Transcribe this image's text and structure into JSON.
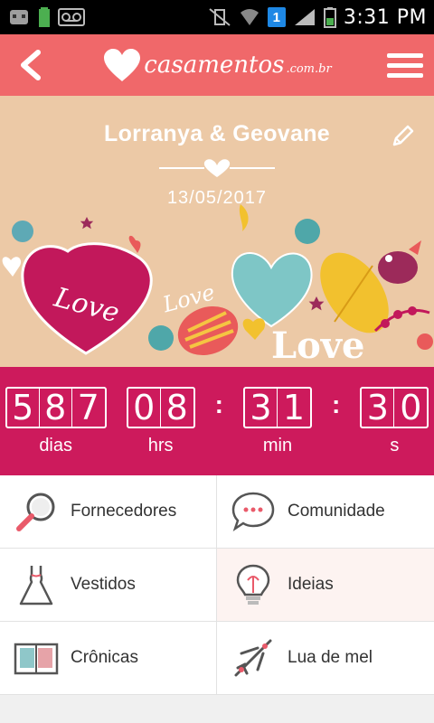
{
  "status_bar": {
    "time": "3:31 PM",
    "notification_badge": "1"
  },
  "header": {
    "logo_text": "casamentos",
    "logo_tld": ".com.br",
    "brand_color": "#f0686a"
  },
  "hero": {
    "couple_names": "Lorranya & Geovane",
    "wedding_date": "13/05/2017",
    "art_words": [
      "Love",
      "Love",
      "Love"
    ]
  },
  "countdown": {
    "days": [
      "5",
      "8",
      "7"
    ],
    "days_label": "dias",
    "hours": [
      "0",
      "8"
    ],
    "hours_label": "hrs",
    "minutes": [
      "3",
      "1"
    ],
    "minutes_label": "min",
    "seconds": [
      "3",
      "0"
    ],
    "seconds_label": "s",
    "color": "#cd1a5c"
  },
  "menu": [
    {
      "label": "Fornecedores",
      "icon": "magnifier-icon"
    },
    {
      "label": "Comunidade",
      "icon": "chat-bubble-icon"
    },
    {
      "label": "Vestidos",
      "icon": "dress-icon"
    },
    {
      "label": "Ideias",
      "icon": "lightbulb-icon"
    },
    {
      "label": "Crônicas",
      "icon": "photo-album-icon"
    },
    {
      "label": "Lua de mel",
      "icon": "airplane-icon"
    }
  ]
}
